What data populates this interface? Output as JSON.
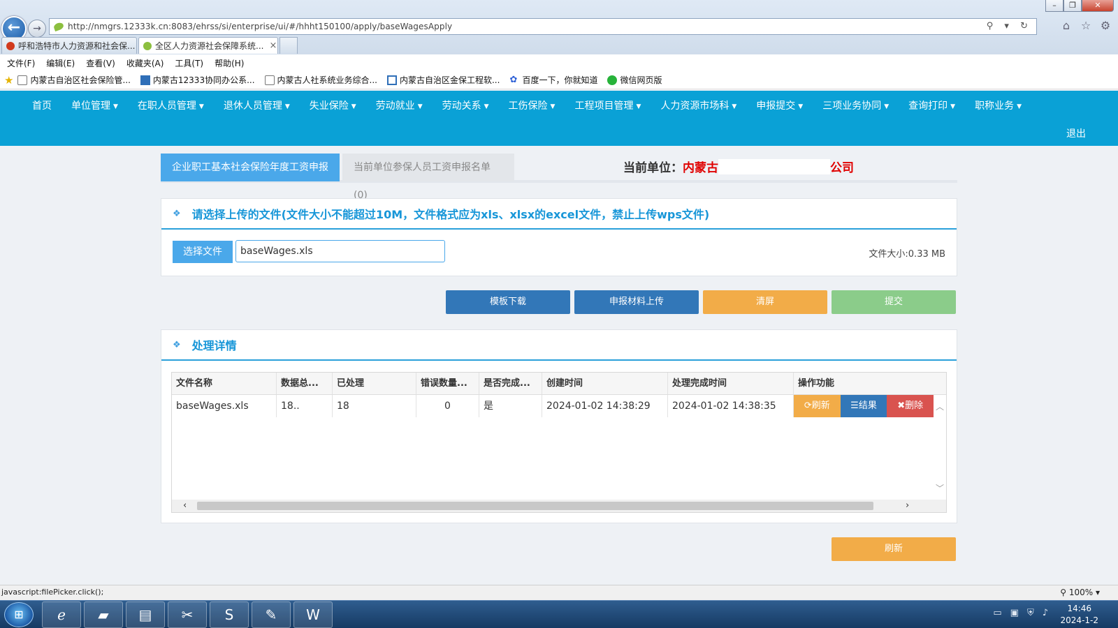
{
  "browser": {
    "address": "http://nmgrs.12333k.cn:8083/ehrss/si/enterprise/ui/#/hhht150100/apply/baseWagesApply",
    "tabs": [
      {
        "label": "呼和浩特市人力资源和社会保..."
      },
      {
        "label": "全区人力资源社会保障系统...",
        "close": "×"
      }
    ],
    "menu": [
      "文件(F)",
      "编辑(E)",
      "查看(V)",
      "收藏夹(A)",
      "工具(T)",
      "帮助(H)"
    ],
    "favorites": [
      "内蒙古自治区社会保险管...",
      "内蒙古12333协同办公系...",
      "内蒙古人社系统业务综合...",
      "内蒙古自治区金保工程软...",
      "百度一下，你就知道",
      "微信网页版"
    ],
    "status_text": "javascript:filePicker.click();",
    "zoom": "100%"
  },
  "nav": {
    "items": [
      {
        "label": "首页",
        "caret": ""
      },
      {
        "label": "单位管理",
        "caret": "▼"
      },
      {
        "label": "在职人员管理",
        "caret": "▼"
      },
      {
        "label": "退休人员管理",
        "caret": "▼"
      },
      {
        "label": "失业保险",
        "caret": "▼"
      },
      {
        "label": "劳动就业",
        "caret": "▼"
      },
      {
        "label": "劳动关系",
        "caret": "▼"
      },
      {
        "label": "工伤保险",
        "caret": "▼"
      },
      {
        "label": "工程项目管理",
        "caret": "▼"
      },
      {
        "label": "人力资源市场科",
        "caret": "▼"
      },
      {
        "label": "申报提交",
        "caret": "▼"
      },
      {
        "label": "三项业务协同",
        "caret": "▼"
      },
      {
        "label": "查询打印",
        "caret": "▼"
      },
      {
        "label": "职称业务",
        "caret": "▼"
      }
    ],
    "logout": "退出"
  },
  "page": {
    "tab_active": "企业职工基本社会保险年度工资申报",
    "tab_inactive": "当前单位参保人员工资申报名单(0)",
    "current_unit_label": "当前单位：",
    "current_unit_prefix": "内蒙古",
    "current_unit_suffix": "公司"
  },
  "upload": {
    "title": "请选择上传的文件(文件大小不能超过10M，文件格式应为xls、xlsx的excel文件，禁止上传wps文件)",
    "choose_label": "选择文件",
    "file_name": "baseWages.xls",
    "file_size": "文件大小:0.33 MB"
  },
  "actions": {
    "template": "模板下载",
    "material": "申报材料上传",
    "clear": "清屏",
    "submit": "提交",
    "refresh": "刷新"
  },
  "detail": {
    "title": "处理详情",
    "columns": [
      "文件名称",
      "数据总...",
      "已处理",
      "错误数量...",
      "是否完成...",
      "创建时间",
      "处理完成时间",
      "操作功能"
    ],
    "row": {
      "file_name": "baseWages.xls",
      "total": "18..",
      "processed": "18",
      "errors": "0",
      "completed": "是",
      "created": "2024-01-02 14:38:29",
      "finished": "2024-01-02 14:38:35"
    },
    "ops": {
      "refresh": "刷新",
      "result": "结果",
      "delete": "删除"
    }
  },
  "taskbar": {
    "time": "14:46",
    "date": "2024-1-2"
  },
  "colors": {
    "nav_bg": "#0aa1d6",
    "primary": "#4aa8ea",
    "dark_blue": "#3277b8",
    "orange": "#f2ac48",
    "green": "#8bcc8a",
    "red": "#d9534f"
  }
}
